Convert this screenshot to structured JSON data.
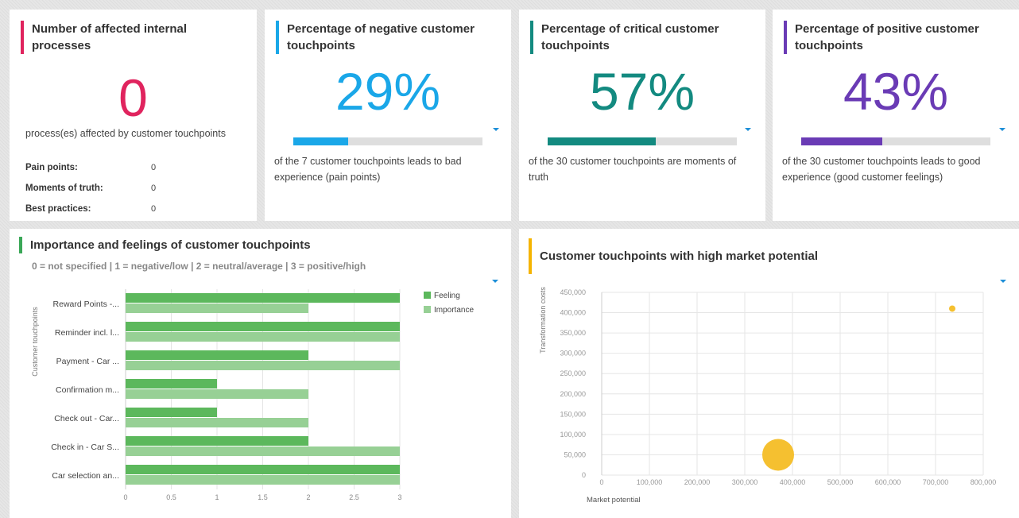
{
  "kpi_processes": {
    "title_line1": "Number of affected internal",
    "title_line2": "processes",
    "value": "0",
    "description": "process(es) affected by customer touchpoints",
    "rows": [
      {
        "label": "Pain points:",
        "value": "0"
      },
      {
        "label": "Moments of truth:",
        "value": "0"
      },
      {
        "label": "Best practices:",
        "value": "0"
      }
    ],
    "accent": "#e0245e"
  },
  "kpi_negative": {
    "title_line1": "Percentage of negative customer",
    "title_line2": "touchpoints",
    "value": "29%",
    "progress": 0.29,
    "desc_line1": "of the 7 customer touchpoints leads to bad",
    "desc_line2": "experience (pain points)",
    "accent": "#1aa7e8"
  },
  "kpi_critical": {
    "title_line1": "Percentage of critical customer",
    "title_line2": "touchpoints",
    "value": "57%",
    "progress": 0.57,
    "desc_line1": "of the 30 customer touchpoints are moments of",
    "desc_line2": "truth",
    "accent": "#138a80"
  },
  "kpi_positive": {
    "title_line1": "Percentage of positive customer",
    "title_line2": "touchpoints",
    "value": "43%",
    "progress": 0.43,
    "desc_line1": "of the 30 customer touchpoints leads to good",
    "desc_line2": "experience (good customer feelings)",
    "accent": "#6a3bb5"
  },
  "importance_panel": {
    "title": "Importance and feelings of customer touchpoints",
    "subtitle": "0 = not specified | 1 = negative/low | 2 = neutral/average | 3 = positive/high",
    "accent": "#3aa757"
  },
  "market_panel": {
    "title": "Customer touchpoints with high market potential",
    "accent": "#f5b400"
  },
  "chart_data": [
    {
      "type": "bar",
      "orientation": "horizontal",
      "categories": [
        "Reward Points -...",
        "Reminder incl. l...",
        "Payment - Car ...",
        "Confirmation m...",
        "Check out - Car...",
        "Check in - Car S...",
        "Car selection an..."
      ],
      "series": [
        {
          "name": "Feeling",
          "values": [
            3,
            3,
            2,
            1,
            1,
            2,
            3
          ],
          "color": "#5cb85c"
        },
        {
          "name": "Importance",
          "values": [
            2,
            3,
            3,
            2,
            2,
            3,
            3
          ],
          "color": "#97d095"
        }
      ],
      "xlim": [
        0,
        3
      ],
      "xticks": [
        "0",
        "0.5",
        "1",
        "1.5",
        "2",
        "2.5",
        "3"
      ],
      "ylabel": "Customer touchpoints",
      "legend": "top-right",
      "grid": true
    },
    {
      "type": "scatter",
      "points": [
        {
          "x": 735000,
          "y": 410000,
          "size": 1
        },
        {
          "x": 370000,
          "y": 50000,
          "size": 5
        }
      ],
      "color": "#f5c030",
      "xlim": [
        0,
        800000
      ],
      "ylim": [
        0,
        450000
      ],
      "xticks": [
        "0",
        "100,000",
        "200,000",
        "300,000",
        "400,000",
        "500,000",
        "600,000",
        "700,000",
        "800,000"
      ],
      "yticks": [
        "0",
        "50,000",
        "100,000",
        "150,000",
        "200,000",
        "250,000",
        "300,000",
        "350,000",
        "400,000",
        "450,000"
      ],
      "xlabel": "Market potential",
      "ylabel": "Transformation costs",
      "grid": true
    }
  ]
}
